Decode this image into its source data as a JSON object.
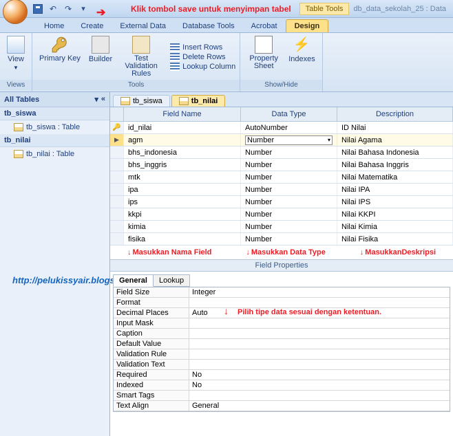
{
  "title_note": "Klik tombol save untuk menyimpan tabel",
  "tabletools_label": "Table Tools",
  "db_name": "db_data_sekolah_25 : Data",
  "tabs": {
    "home": "Home",
    "create": "Create",
    "external": "External Data",
    "dbtools": "Database Tools",
    "acrobat": "Acrobat",
    "design": "Design"
  },
  "ribbon": {
    "views": {
      "view": "View",
      "label": "Views"
    },
    "tools": {
      "pk": "Primary Key",
      "builder": "Builder",
      "test": "Test Validation Rules",
      "insert": "Insert Rows",
      "delete": "Delete Rows",
      "lookup": "Lookup Column",
      "label": "Tools"
    },
    "showhide": {
      "prop": "Property Sheet",
      "idx": "Indexes",
      "label": "Show/Hide"
    }
  },
  "nav": {
    "head": "All Tables",
    "g1": "tb_siswa",
    "i1": "tb_siswa : Table",
    "g2": "tb_nilai",
    "i2": "tb_nilai : Table"
  },
  "doctabs": {
    "t1": "tb_siswa",
    "t2": "tb_nilai"
  },
  "cols": {
    "fn": "Field Name",
    "dt": "Data Type",
    "de": "Description"
  },
  "fields": [
    {
      "name": "id_nilai",
      "type": "AutoNumber",
      "desc": "ID Nilai",
      "pk": true
    },
    {
      "name": "agm",
      "type": "Number",
      "desc": "Nilai Agama",
      "sel": true
    },
    {
      "name": "bhs_indonesia",
      "type": "Number",
      "desc": "Nilai Bahasa Indonesia"
    },
    {
      "name": "bhs_inggris",
      "type": "Number",
      "desc": "Nilai Bahasa Inggris"
    },
    {
      "name": "mtk",
      "type": "Number",
      "desc": "Nilai Matematika"
    },
    {
      "name": "ipa",
      "type": "Number",
      "desc": "Nilai IPA"
    },
    {
      "name": "ips",
      "type": "Number",
      "desc": "Nilai IPS"
    },
    {
      "name": "kkpi",
      "type": "Number",
      "desc": "Nilai KKPI"
    },
    {
      "name": "kimia",
      "type": "Number",
      "desc": "Nilai Kimia"
    },
    {
      "name": "fisika",
      "type": "Number",
      "desc": "Nilai Fisika"
    }
  ],
  "annot": {
    "a1": "Masukkan Nama Field",
    "a2": "Masukkan Data Type",
    "a3": "MasukkanDeskripsi"
  },
  "blog": "http://pelukissyair.blogspot.com",
  "fp": {
    "head": "Field Properties",
    "tab1": "General",
    "tab2": "Lookup",
    "note": "Pilih tipe data sesuai dengan ketentuan."
  },
  "props": [
    {
      "l": "Field Size",
      "v": "Integer"
    },
    {
      "l": "Format",
      "v": ""
    },
    {
      "l": "Decimal Places",
      "v": "Auto"
    },
    {
      "l": "Input Mask",
      "v": ""
    },
    {
      "l": "Caption",
      "v": ""
    },
    {
      "l": "Default Value",
      "v": ""
    },
    {
      "l": "Validation Rule",
      "v": ""
    },
    {
      "l": "Validation Text",
      "v": ""
    },
    {
      "l": "Required",
      "v": "No"
    },
    {
      "l": "Indexed",
      "v": "No"
    },
    {
      "l": "Smart Tags",
      "v": ""
    },
    {
      "l": "Text Align",
      "v": "General"
    }
  ]
}
